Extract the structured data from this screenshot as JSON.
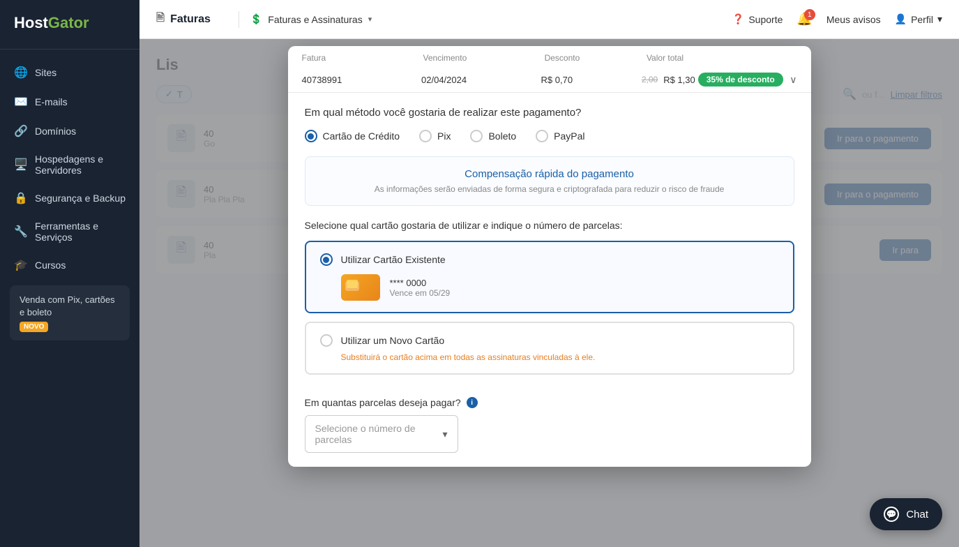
{
  "sidebar": {
    "logo_host": "Host",
    "logo_gator": "Gator",
    "items": [
      {
        "id": "sites",
        "label": "Sites",
        "icon": "🌐"
      },
      {
        "id": "emails",
        "label": "E-mails",
        "icon": "✉️"
      },
      {
        "id": "domains",
        "label": "Domínios",
        "icon": "🔗"
      },
      {
        "id": "hosting",
        "label": "Hospedagens e Servidores",
        "icon": "🖥️"
      },
      {
        "id": "security",
        "label": "Segurança e Backup",
        "icon": "🔒"
      },
      {
        "id": "tools",
        "label": "Ferramentas e Serviços",
        "icon": "🔧"
      },
      {
        "id": "courses",
        "label": "Cursos",
        "icon": "🎓"
      }
    ],
    "special_item": {
      "label": "Venda com Pix, cartões e boleto",
      "badge": "NOVO"
    }
  },
  "topnav": {
    "page_icon": "🖹",
    "page_title": "Faturas",
    "section_icon": "💲",
    "section_label": "Faturas e Assinaturas",
    "support_icon": "❓",
    "support_label": "Suporte",
    "bell_count": "1",
    "notices_label": "Meus avisos",
    "profile_icon": "👤",
    "profile_label": "Perfil"
  },
  "page": {
    "heading": "Lis",
    "filter_tag": "T",
    "filter_placeholder": "ou f...",
    "clear_filters": "Limpar filtros"
  },
  "bg_rows": [
    {
      "id": "40",
      "desc1": "Go",
      "btn": "Ir para o pagamento"
    },
    {
      "id": "40",
      "desc1": "Pla",
      "desc2": "Pla",
      "desc3": "Pla",
      "btn": "Ir para o pagamento"
    },
    {
      "id": "40",
      "desc1": "Pla",
      "btn": "Ir para"
    }
  ],
  "modal": {
    "invoice_table": {
      "headers": [
        "Fatura",
        "Vencimento",
        "Desconto",
        "Valor total",
        ""
      ],
      "row": {
        "id": "40738991",
        "due_date": "02/04/2024",
        "discount": "R$ 0,70",
        "original_price": "2,00",
        "final_price": "R$ 1,30",
        "badge": "35% de desconto"
      }
    },
    "payment_method_question": "Em qual método você gostaria de realizar este pagamento?",
    "payment_methods": [
      {
        "id": "credit",
        "label": "Cartão de Crédito",
        "selected": true
      },
      {
        "id": "pix",
        "label": "Pix",
        "selected": false
      },
      {
        "id": "boleto",
        "label": "Boleto",
        "selected": false
      },
      {
        "id": "paypal",
        "label": "PayPal",
        "selected": false
      }
    ],
    "fast_compensation_title": "Compensação rápida do pagamento",
    "fast_compensation_desc": "As informações serão enviadas de forma segura e criptografada para reduzir o risco de fraude",
    "card_section_title": "Selecione qual cartão gostaria de utilizar e indique o número de parcelas:",
    "card_options": [
      {
        "id": "existing",
        "label": "Utilizar Cartão Existente",
        "selected": true,
        "card_number": "**** 0000",
        "card_expiry": "Vence em 05/29"
      },
      {
        "id": "new",
        "label": "Utilizar um Novo Cartão",
        "selected": false,
        "warning": "Substituirá o cartão acima em todas as assinaturas vinculadas à ele."
      }
    ],
    "installments_label": "Em quantas parcelas deseja pagar?",
    "installments_placeholder": "Selecione o número de parcelas"
  },
  "chat": {
    "label": "Chat",
    "icon": "💬"
  }
}
